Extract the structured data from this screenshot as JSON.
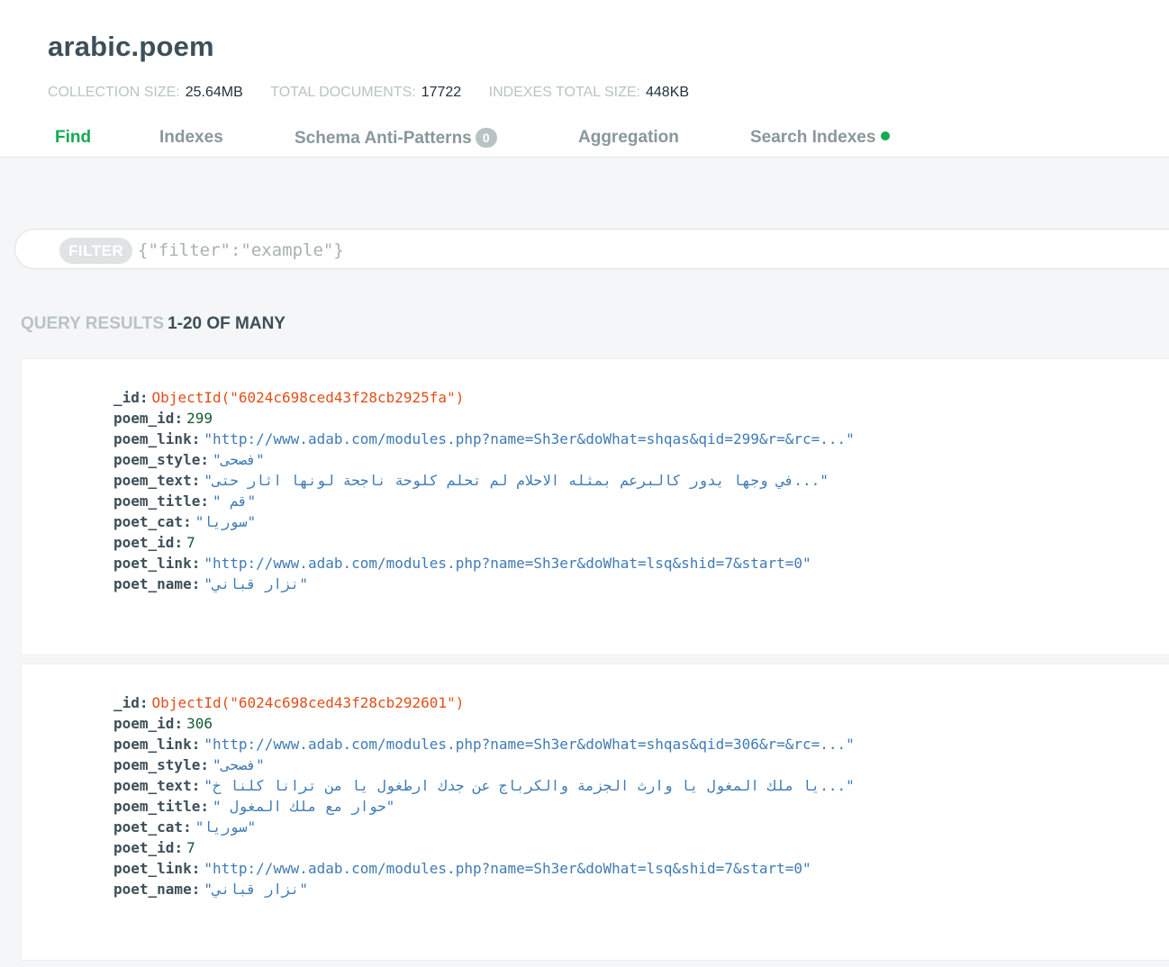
{
  "collection": {
    "title": "arabic.poem",
    "stats": [
      {
        "label": "COLLECTION SIZE:",
        "value": "25.64MB"
      },
      {
        "label": "TOTAL DOCUMENTS:",
        "value": "17722"
      },
      {
        "label": "INDEXES TOTAL SIZE:",
        "value": "448KB"
      }
    ]
  },
  "tabs": [
    {
      "label": "Find",
      "active": true
    },
    {
      "label": "Indexes"
    },
    {
      "label": "Schema Anti-Patterns",
      "badge": "0"
    },
    {
      "label": "Aggregation"
    },
    {
      "label": "Search Indexes",
      "status_dot": true
    }
  ],
  "filter": {
    "label": "FILTER",
    "placeholder": "{\"filter\":\"example\"}",
    "value": ""
  },
  "results": {
    "label": "QUERY RESULTS",
    "range": "1-20 OF MANY"
  },
  "documents": [
    {
      "_id": "ObjectId(\"6024c698ced43f28cb2925fa\")",
      "poem_id": "299",
      "poem_link": "\"http://www.adab.com/modules.php?name=Sh3er&doWhat=shqas&qid=299&r=&rc=...\"",
      "poem_style": "\"فصحى\"",
      "poem_text": "\"في وجها يدور كالبرعم بمثله الاحلام لم تحلم كلوحة ناجحة لونها اثار حتى...\"",
      "poem_title": "\" قم\"",
      "poet_cat": "\"سوريا\"",
      "poet_id": "7",
      "poet_link": "\"http://www.adab.com/modules.php?name=Sh3er&doWhat=lsq&shid=7&start=0\"",
      "poet_name": "\"نزار قباني\""
    },
    {
      "_id": "ObjectId(\"6024c698ced43f28cb292601\")",
      "poem_id": "306",
      "poem_link": "\"http://www.adab.com/modules.php?name=Sh3er&doWhat=shqas&qid=306&r=&rc=...\"",
      "poem_style": "\"فصحى\"",
      "poem_text": "\"يا ملك المغول يا وارث الجزمة والكرباج عن جدك ارطغول يا من ترانا كلنا خ...\"",
      "poem_title": "\" حوار مع ملك المغول\"",
      "poet_cat": "\"سوريا\"",
      "poet_id": "7",
      "poet_link": "\"http://www.adab.com/modules.php?name=Sh3er&doWhat=lsq&shid=7&start=0\"",
      "poet_name": "\"نزار قباني\""
    }
  ],
  "colors": {
    "active_tab": "#13aa52",
    "objectid": "#e14f1a",
    "number": "#145a32",
    "string": "#3f7bb4"
  }
}
